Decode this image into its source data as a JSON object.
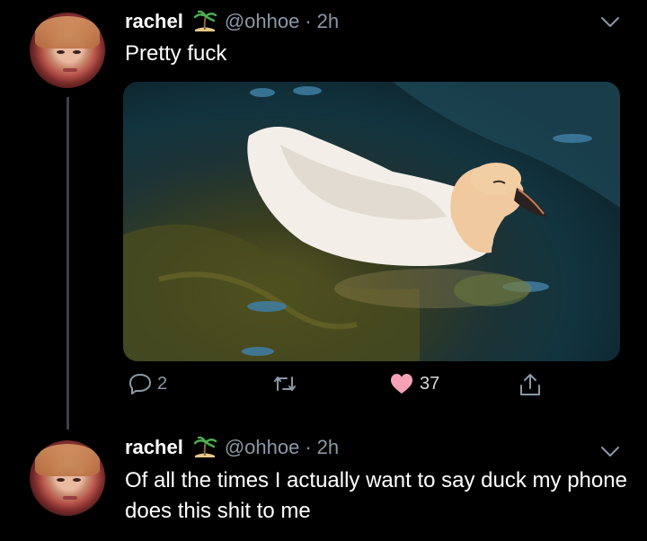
{
  "tweets": [
    {
      "name": "rachel",
      "handle": "@ohhoe",
      "separator": "·",
      "time": "2h",
      "text": "Pretty fuck",
      "actions": {
        "replies": "2",
        "retweets": "",
        "likes": "37"
      }
    },
    {
      "name": "rachel",
      "handle": "@ohhoe",
      "separator": "·",
      "time": "2h",
      "text": "Of all the times I actually want to say duck my phone does this shit to me"
    }
  ],
  "colors": {
    "background": "#000000",
    "secondary_text": "#8b98a5",
    "like_heart": "#f6a1b8",
    "thread_line": "#3c3f43"
  },
  "icons": [
    "island-icon",
    "chevron-down-icon",
    "reply-icon",
    "retweet-icon",
    "heart-icon",
    "share-icon"
  ]
}
